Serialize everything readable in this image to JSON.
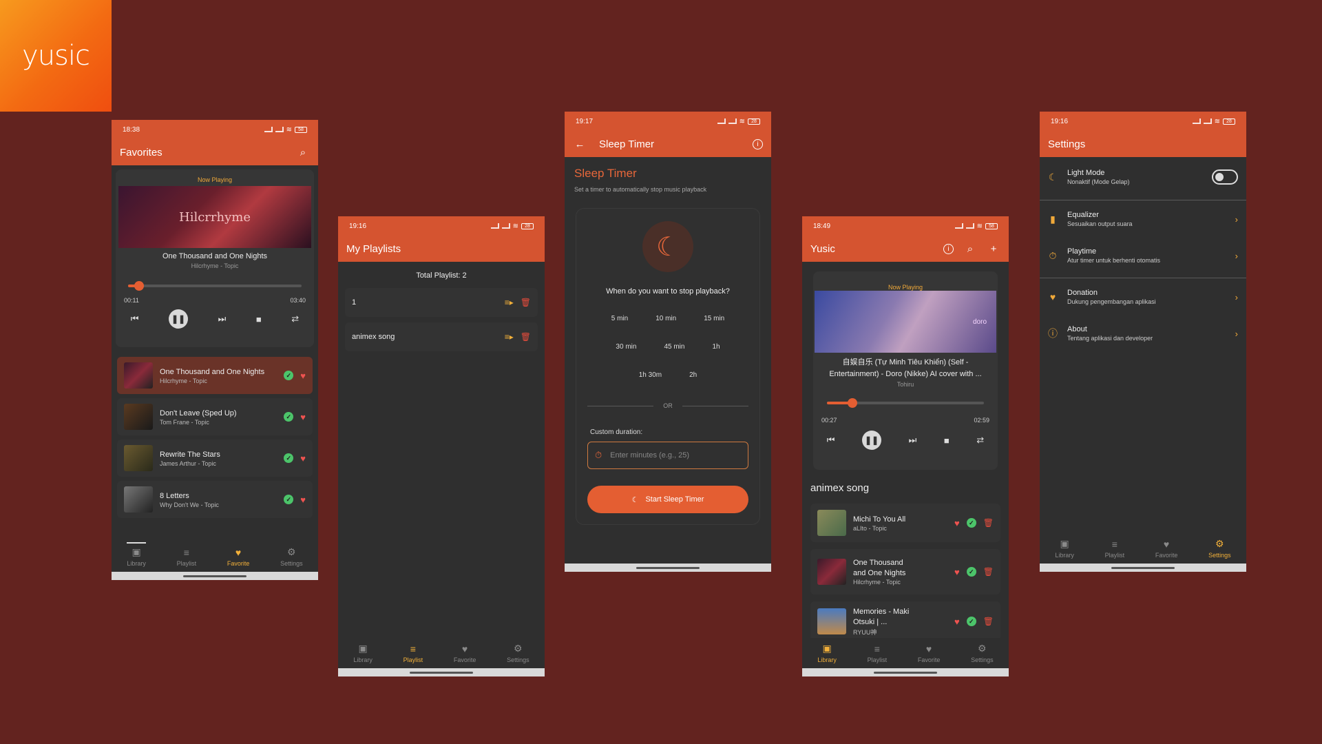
{
  "brand": {
    "logo": "yusic"
  },
  "phone1": {
    "time": "18:38",
    "battery": "58",
    "title": "Favorites",
    "now_playing": "Now Playing",
    "cover_text": "Hilcrrhyme",
    "song_title": "One Thousand and One Nights",
    "song_artist": "Hilcrhyme - Topic",
    "elapsed": "00:11",
    "duration": "03:40",
    "progress": 0.05,
    "tracks": [
      {
        "title": "One Thousand and One Nights",
        "artist": "Hilcrhyme - Topic"
      },
      {
        "title": "Don't Leave (Sped Up)",
        "artist": "Tom Frane - Topic"
      },
      {
        "title": "Rewrite The Stars",
        "artist": "James Arthur - Topic"
      },
      {
        "title": "8 Letters",
        "artist": "Why Don't We - Topic"
      }
    ],
    "nav": [
      "Library",
      "Playlist",
      "Favorite",
      "Settings"
    ]
  },
  "phone2": {
    "time": "19:16",
    "battery": "28",
    "title": "My Playlists",
    "total": "Total Playlist: 2",
    "playlists": [
      {
        "name": "1"
      },
      {
        "name": "animex song"
      }
    ],
    "nav": [
      "Library",
      "Playlist",
      "Favorite",
      "Settings"
    ]
  },
  "phone3": {
    "time": "19:17",
    "battery": "28",
    "title": "Sleep Timer",
    "heading": "Sleep Timer",
    "subheading": "Set a timer to automatically stop music playback",
    "question": "When do you want to stop playback?",
    "options": [
      "5 min",
      "10 min",
      "15 min",
      "30 min",
      "45 min",
      "1h",
      "1h 30m",
      "2h"
    ],
    "or": "OR",
    "custom_label": "Custom duration:",
    "custom_placeholder": "Enter minutes (e.g., 25)",
    "start": "Start Sleep Timer"
  },
  "phone4": {
    "time": "18:49",
    "battery": "58",
    "title": "Yusic",
    "now_playing": "Now Playing",
    "cover_text": "doro",
    "song_title": "自娱自乐 (Tự Minh Tiêu Khiển) (Self - Entertainment) - Doro (Nikke) AI cover with ...",
    "song_artist": "Tohiru",
    "elapsed": "00:27",
    "duration": "02:59",
    "progress": 0.15,
    "section": "animex song",
    "tracks": [
      {
        "title": "Michi To You All",
        "artist": "aLIto - Topic"
      },
      {
        "title": "One Thousand and One Nights",
        "artist": "Hilcrhyme - Topic"
      },
      {
        "title": "Memories - Maki Otsuki | ...",
        "artist": "RYUU神"
      }
    ],
    "nav": [
      "Library",
      "Playlist",
      "Favorite",
      "Settings"
    ]
  },
  "phone5": {
    "time": "19:16",
    "battery": "28",
    "title": "Settings",
    "items": [
      {
        "title": "Light Mode",
        "sub": "Nonaktif (Mode Gelap)"
      },
      {
        "title": "Equalizer",
        "sub": "Sesuaikan output suara"
      },
      {
        "title": "Playtime",
        "sub": "Atur timer untuk berhenti otomatis"
      },
      {
        "title": "Donation",
        "sub": "Dukung pengembangan aplikasi"
      },
      {
        "title": "About",
        "sub": "Tentang aplikasi dan developer"
      }
    ],
    "nav": [
      "Library",
      "Playlist",
      "Favorite",
      "Settings"
    ]
  },
  "colors": {
    "accent": "#d55430",
    "favorite": "#f2b03a",
    "background": "#63231f"
  }
}
